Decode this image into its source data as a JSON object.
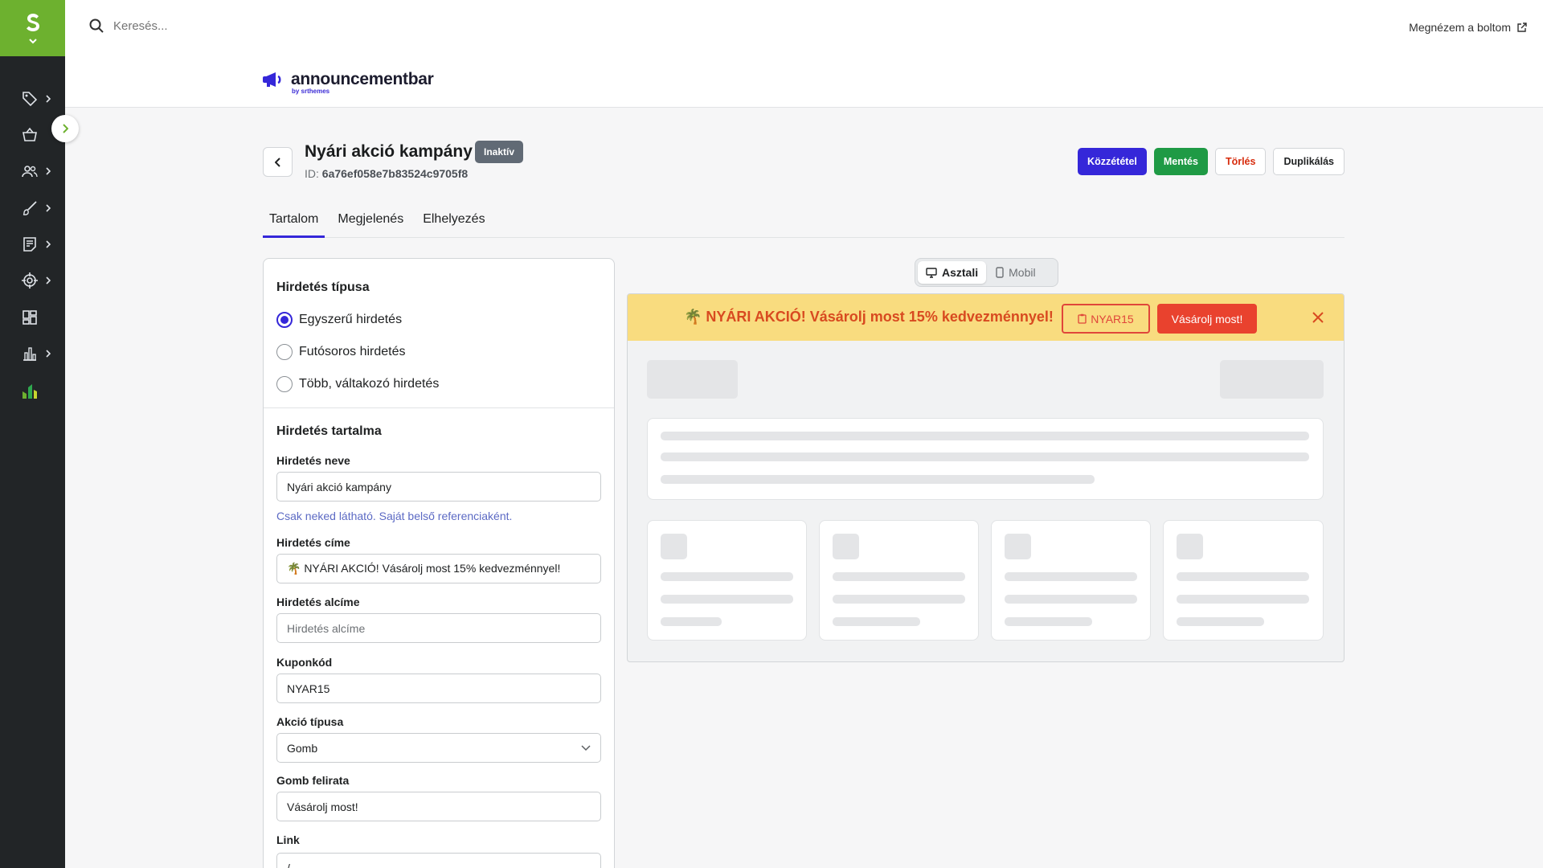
{
  "sidebar": {
    "items": [
      {
        "icon": "tag-icon",
        "has_chevron": true
      },
      {
        "icon": "basket-icon",
        "has_chevron": false
      },
      {
        "icon": "customers-icon",
        "has_chevron": true
      },
      {
        "icon": "brush-icon",
        "has_chevron": true
      },
      {
        "icon": "content-icon",
        "has_chevron": true
      },
      {
        "icon": "target-icon",
        "has_chevron": true
      },
      {
        "icon": "apps-icon",
        "has_chevron": false
      },
      {
        "icon": "analytics-icon",
        "has_chevron": true
      },
      {
        "icon": "app-logo-icon",
        "has_chevron": false
      }
    ],
    "accent": "#6db12f"
  },
  "topbar": {
    "search_placeholder": "Keresés...",
    "store_link": "Megnézem a boltom"
  },
  "app": {
    "brand": "announcementbar",
    "brand_sub": "by srthemes"
  },
  "page": {
    "title": "Nyári akció kampány",
    "status": "Inaktív",
    "id_label": "ID:",
    "id_value": "6a76ef058e7b83524c9705f8",
    "actions": {
      "publish": "Közzététel",
      "save": "Mentés",
      "delete": "Törlés",
      "duplicate": "Duplikálás"
    }
  },
  "tabs": [
    "Tartalom",
    "Megjelenés",
    "Elhelyezés"
  ],
  "form": {
    "type_section": "Hirdetés típusa",
    "type_options": [
      "Egyszerű hirdetés",
      "Futósoros hirdetés",
      "Több, váltakozó hirdetés"
    ],
    "type_selected": 0,
    "content_section": "Hirdetés tartalma",
    "name_label": "Hirdetés neve",
    "name_value": "Nyári akció kampány",
    "name_help": "Csak neked látható. Saját belső referenciaként.",
    "title_label": "Hirdetés címe",
    "title_value": "🌴 NYÁRI AKCIÓ! Vásárolj most 15% kedvezménnyel!",
    "subtitle_label": "Hirdetés alcíme",
    "subtitle_placeholder": "Hirdetés alcíme",
    "coupon_label": "Kuponkód",
    "coupon_value": "NYAR15",
    "action_label": "Akció típusa",
    "action_value": "Gomb",
    "button_label": "Gomb felirata",
    "button_value": "Vásárolj most!",
    "link_label": "Link",
    "link_value": "/"
  },
  "preview": {
    "view_desktop": "Asztali",
    "view_mobile": "Mobil",
    "bar_text": "NYÁRI AKCIÓ! Vásárolj most 15% kedvezménnyel!",
    "bar_emoji": "🌴",
    "bar_coupon": "NYAR15",
    "bar_cta": "Vásárolj most!",
    "bar_bg": "#f9dc7f",
    "bar_text_color": "#d84a20",
    "cta_color": "#e9422e"
  }
}
